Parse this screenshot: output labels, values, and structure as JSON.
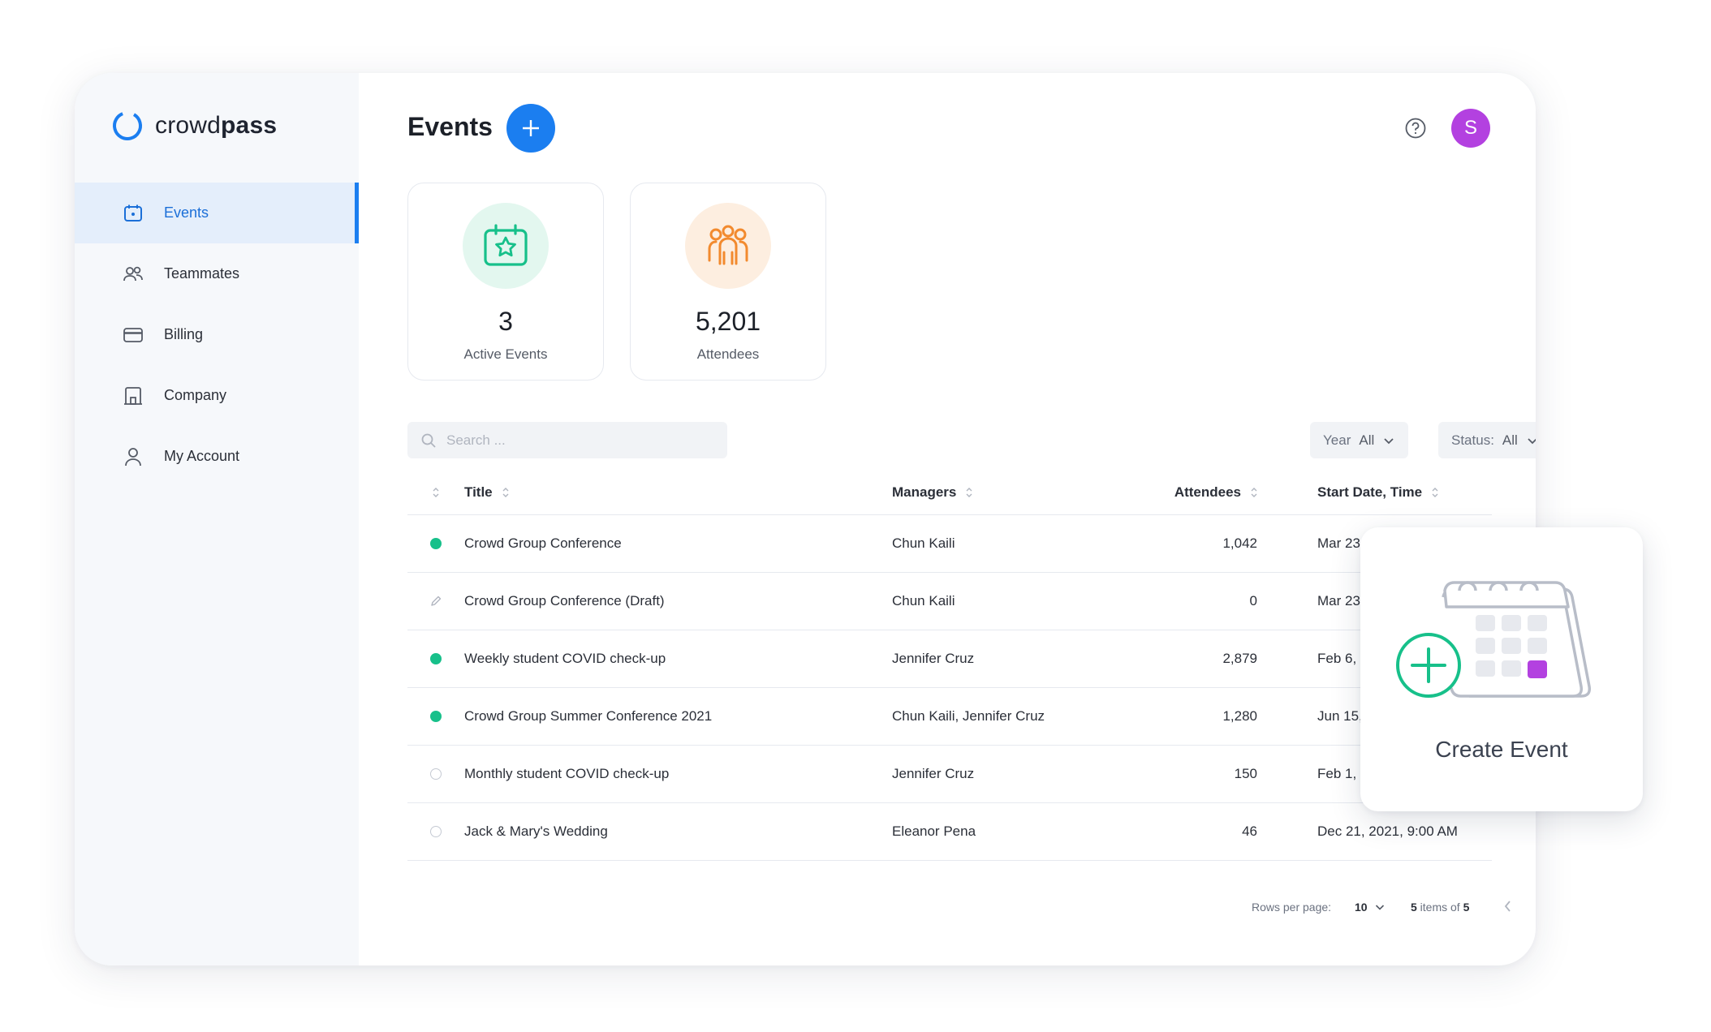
{
  "brand": {
    "name_regular": "crowd",
    "name_bold": "pass",
    "color": "#1b7ef0"
  },
  "sidebar": {
    "items": [
      {
        "label": "Events",
        "icon": "calendar-icon",
        "active": true
      },
      {
        "label": "Teammates",
        "icon": "users-icon"
      },
      {
        "label": "Billing",
        "icon": "credit-card-icon"
      },
      {
        "label": "Company",
        "icon": "building-icon"
      },
      {
        "label": "My Account",
        "icon": "user-icon"
      }
    ]
  },
  "header": {
    "title": "Events",
    "add_icon": "plus-icon",
    "help_icon": "help-circle-icon",
    "avatar_initial": "S",
    "avatar_color": "#b341e0"
  },
  "stats": [
    {
      "value": "3",
      "label": "Active Events",
      "icon": "calendar-star-icon",
      "color": "#17c08a"
    },
    {
      "value": "5,201",
      "label": "Attendees",
      "icon": "group-icon",
      "color": "#f28a2e"
    }
  ],
  "search": {
    "placeholder": "Search ..."
  },
  "filters": {
    "year": {
      "label": "Year",
      "value": "All"
    },
    "status": {
      "label": "Status:",
      "value": "All"
    }
  },
  "table": {
    "columns": [
      "Title",
      "Managers",
      "Attendees",
      "Start Date, Time"
    ],
    "rows": [
      {
        "status": "active",
        "title": "Crowd Group Conference",
        "managers": "Chun Kaili",
        "attendees": "1,042",
        "date": "Mar 23,"
      },
      {
        "status": "draft",
        "title": "Crowd Group Conference (Draft)",
        "managers": "Chun Kaili",
        "attendees": "0",
        "date": "Mar 23,"
      },
      {
        "status": "active",
        "title": "Weekly student COVID check-up",
        "managers": "Jennifer Cruz",
        "attendees": "2,879",
        "date": "Feb 6, 2"
      },
      {
        "status": "active",
        "title": "Crowd Group Summer Conference 2021",
        "managers": "Chun Kaili, Jennifer Cruz",
        "attendees": "1,280",
        "date": "Jun 15,"
      },
      {
        "status": "inactive",
        "title": "Monthly student COVID check-up",
        "managers": "Jennifer Cruz",
        "attendees": "150",
        "date": "Feb 1, 2"
      },
      {
        "status": "inactive",
        "title": "Jack & Mary's Wedding",
        "managers": "Eleanor Pena",
        "attendees": "46",
        "date": "Dec 21, 2021, 9:00 AM"
      }
    ]
  },
  "pagination": {
    "rows_label": "Rows per page:",
    "rows_value": "10",
    "items_shown": "5",
    "items_mid": " items of ",
    "items_total": "5"
  },
  "create_card": {
    "label": "Create Event",
    "accent": "#17c08a",
    "highlight": "#b341e0"
  }
}
